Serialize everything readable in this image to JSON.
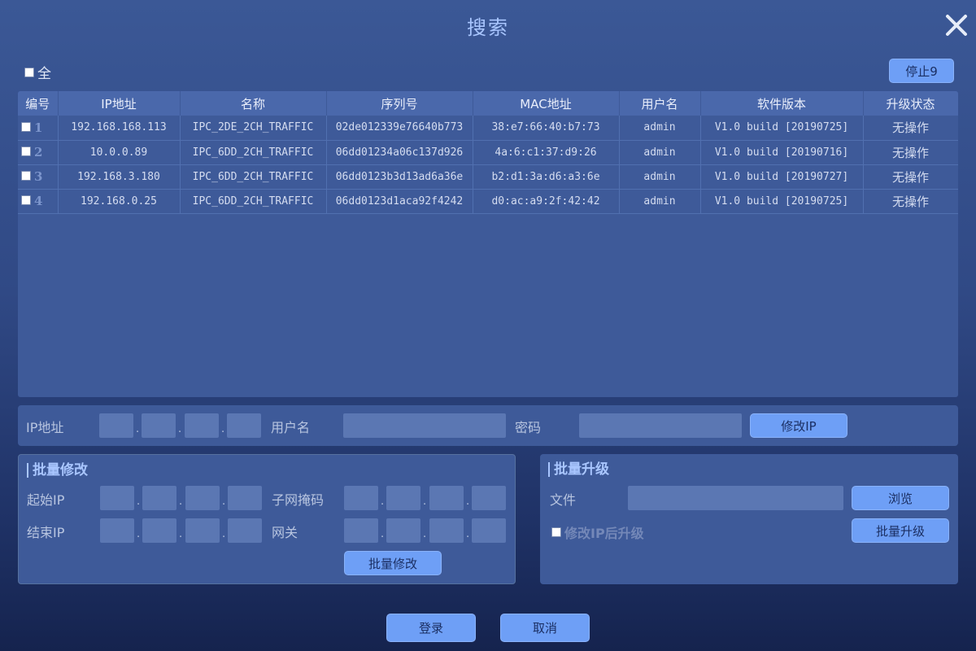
{
  "window": {
    "title": "搜索"
  },
  "toolbar": {
    "select_all_label": "全",
    "stop_label": "停止9"
  },
  "table": {
    "headers": [
      "编号",
      "IP地址",
      "名称",
      "序列号",
      "MAC地址",
      "用户名",
      "软件版本",
      "升级状态"
    ],
    "rows": [
      {
        "index": "1",
        "ip": "192.168.168.113",
        "name": "IPC_2DE_2CH_TRAFFIC",
        "serial": "02de012339e76640b773",
        "mac": "38:e7:66:40:b7:73",
        "user": "admin",
        "version": "V1.0 build [20190725]",
        "status": "无操作"
      },
      {
        "index": "2",
        "ip": "10.0.0.89",
        "name": "IPC_6DD_2CH_TRAFFIC",
        "serial": "06dd01234a06c137d926",
        "mac": "4a:6:c1:37:d9:26",
        "user": "admin",
        "version": "V1.0 build [20190716]",
        "status": "无操作"
      },
      {
        "index": "3",
        "ip": "192.168.3.180",
        "name": "IPC_6DD_2CH_TRAFFIC",
        "serial": "06dd0123b3d13ad6a36e",
        "mac": "b2:d1:3a:d6:a3:6e",
        "user": "admin",
        "version": "V1.0 build [20190727]",
        "status": "无操作"
      },
      {
        "index": "4",
        "ip": "192.168.0.25",
        "name": "IPC_6DD_2CH_TRAFFIC",
        "serial": "06dd0123d1aca92f4242",
        "mac": "d0:ac:a9:2f:42:42",
        "user": "admin",
        "version": "V1.0 build [20190725]",
        "status": "无操作"
      }
    ]
  },
  "ip_form": {
    "ip_label": "IP地址",
    "user_label": "用户名",
    "password_label": "密码",
    "modify_button": "修改IP",
    "ip_separator": "."
  },
  "batch_modify": {
    "title": "批量修改",
    "start_ip_label": "起始IP",
    "subnet_label": "子网掩码",
    "end_ip_label": "结束IP",
    "gateway_label": "网关",
    "button": "批量修改"
  },
  "batch_upgrade": {
    "title": "批量升级",
    "file_label": "文件",
    "browse_button": "浏览",
    "upgrade_after_ip_label": "修改IP后升级",
    "button": "批量升级"
  },
  "footer": {
    "login_button": "登录",
    "cancel_button": "取消"
  },
  "colors": {
    "accent": "#a9c6ff",
    "button": "#6e9ff6",
    "panel": "#3e5a99",
    "field": "#5b77b3"
  }
}
